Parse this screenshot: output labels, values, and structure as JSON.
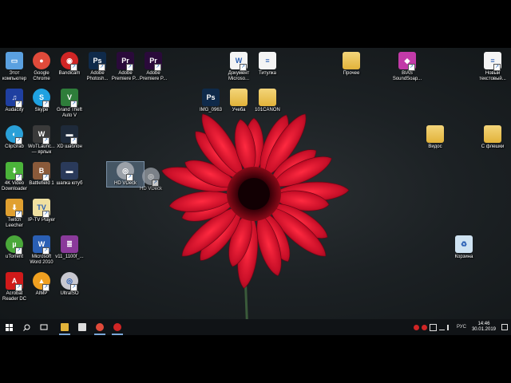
{
  "desktop": {
    "icons": [
      {
        "label": "Этот\nкомпьютер",
        "icon": "computer-icon",
        "color": "#5aa0e0"
      },
      {
        "label": "Google\nChrome",
        "icon": "chrome-icon",
        "color": "#e04a3a"
      },
      {
        "label": "Bandicam",
        "icon": "bandicam-icon",
        "color": "#d02525"
      },
      {
        "label": "Adobe\nPhotosh...",
        "icon": "photoshop-icon",
        "color": "#0f2a4a"
      },
      {
        "label": "Adobe\nPremiere P...",
        "icon": "premiere-icon",
        "color": "#2a0a3a"
      },
      {
        "label": "Adobe\nPremiere P...",
        "icon": "premiere-icon",
        "color": "#2a0a3a"
      },
      {
        "label": "Документ\nMicroso...",
        "icon": "word-doc-icon",
        "color": "#f4f4f4"
      },
      {
        "label": "Титулка",
        "icon": "document-icon",
        "color": "#f4f4f4"
      },
      {
        "label": "Прочее",
        "icon": "folder-icon",
        "color": "#e2b33a"
      },
      {
        "label": "BIAS\nSoundSoap...",
        "icon": "bias-icon",
        "color": "#c23aa8"
      },
      {
        "label": "Новый\nтекстовый...",
        "icon": "text-file-icon",
        "color": "#f4f4f4"
      },
      {
        "label": "Audacity",
        "icon": "audacity-icon",
        "color": "#1f3fa0"
      },
      {
        "label": "Skype",
        "icon": "skype-icon",
        "color": "#1fa1e0"
      },
      {
        "label": "Grand Theft\nAuto V",
        "icon": "gta-icon",
        "color": "#2e7d3a"
      },
      {
        "label": "IMG_0963",
        "icon": "psd-file-icon",
        "color": "#0f2a4a"
      },
      {
        "label": "Учеба",
        "icon": "folder-icon",
        "color": "#e2b33a"
      },
      {
        "label": "101CANON",
        "icon": "folder-icon",
        "color": "#e2b33a"
      },
      {
        "label": "ClipGrab",
        "icon": "clipgrab-icon",
        "color": "#2aa0d8"
      },
      {
        "label": "WoTLaunc...\n— ярлык",
        "icon": "wot-icon",
        "color": "#3a3a3a"
      },
      {
        "label": "XD шаблон",
        "icon": "xd-template-icon",
        "color": "#1e2a3a"
      },
      {
        "label": "Видос",
        "icon": "folder-icon",
        "color": "#e2b33a"
      },
      {
        "label": "С флешки",
        "icon": "folder-icon",
        "color": "#e2b33a"
      },
      {
        "label": "4K Video\nDownloader",
        "icon": "4k-downloader-icon",
        "color": "#4bb43a"
      },
      {
        "label": "Battlefield 1",
        "icon": "battlefield-icon",
        "color": "#8a5a3a"
      },
      {
        "label": "шапка ютуб",
        "icon": "image-file-icon",
        "color": "#2a3a5a"
      },
      {
        "label": "HD VDeck",
        "icon": "hdvdeck-icon",
        "color": "#9aa0a8"
      },
      {
        "label": "HD VDeck",
        "icon": "hdvdeck-icon",
        "color": "#9aa0a8"
      },
      {
        "label": "Twitch\nLeecher",
        "icon": "twitch-leecher-icon",
        "color": "#e0a030"
      },
      {
        "label": "IP-TV Player",
        "icon": "iptv-icon",
        "color": "#f0e0a0"
      },
      {
        "label": "uTorrent",
        "icon": "utorrent-icon",
        "color": "#4aa83a"
      },
      {
        "label": "Microsoft\nWord 2010",
        "icon": "word-icon",
        "color": "#2a5fb4"
      },
      {
        "label": "v11_1100f_...",
        "icon": "archive-icon",
        "color": "#8a3a9a"
      },
      {
        "label": "Корзина",
        "icon": "recycle-bin-icon",
        "color": "#cfe3f2"
      },
      {
        "label": "Acrobat\nReader DC",
        "icon": "acrobat-icon",
        "color": "#d01a1a"
      },
      {
        "label": "AIMP",
        "icon": "aimp-icon",
        "color": "#f0a020"
      },
      {
        "label": "UltraISO",
        "icon": "ultraiso-icon",
        "color": "#c8c8d0"
      }
    ]
  },
  "taskbar": {
    "apps": [
      {
        "name": "file-explorer-icon",
        "color": "#e2b33a"
      },
      {
        "name": "mail-icon",
        "color": "#dddddd"
      },
      {
        "name": "chrome-icon",
        "color": "#e04a3a"
      },
      {
        "name": "bandicam-icon",
        "color": "#d02525"
      }
    ],
    "tray": {
      "language": "РУС",
      "time": "14:46",
      "date": "30.01.2019"
    }
  }
}
